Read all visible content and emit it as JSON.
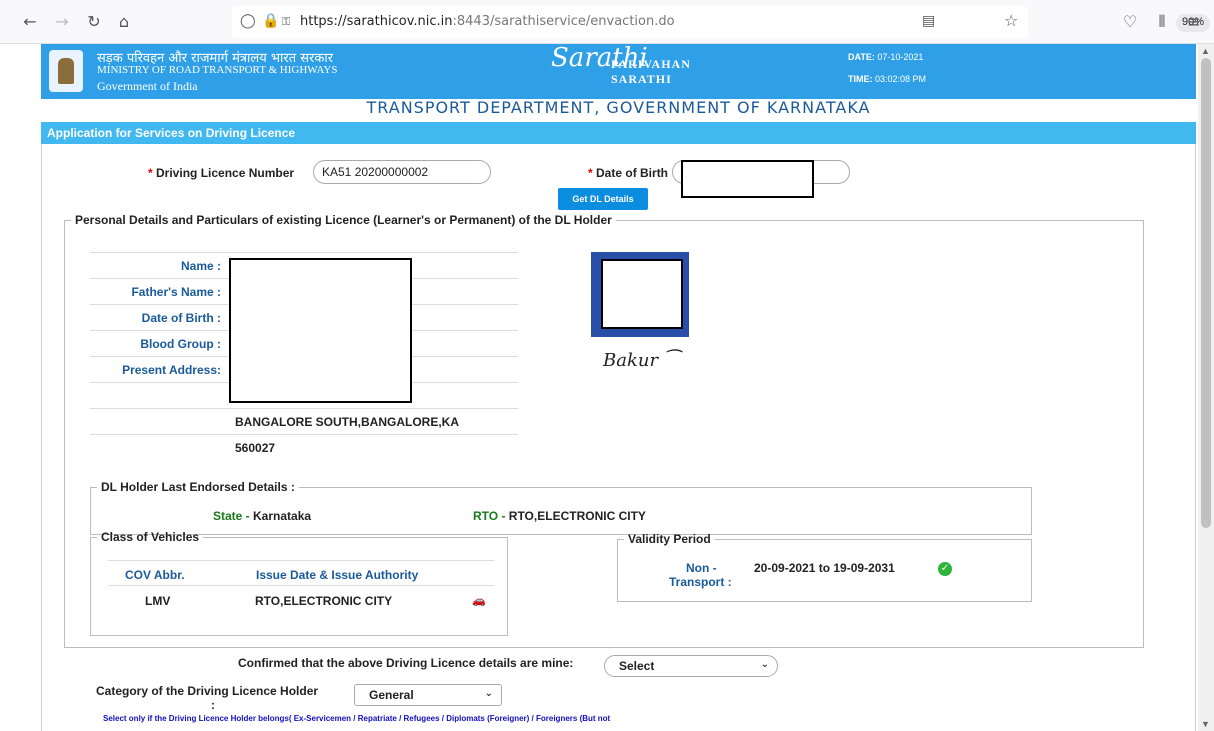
{
  "browser": {
    "url_host": "https://sarathicov.nic.in",
    "url_rest": ":8443/sarathiservice/envaction.do",
    "zoom": "90%"
  },
  "header": {
    "hindi": "सड़क परिवहन और राजमार्ग मंत्रालय भारत सरकार",
    "ministry": "MINISTRY OF ROAD TRANSPORT & HIGHWAYS",
    "gov": "Government of India",
    "logo_line1": "PARIVAHAN",
    "logo_line2": "SARATHI",
    "date_label": "DATE:",
    "date_value": "07-10-2021",
    "time_label": "TIME:",
    "time_value": "03:02:08 PM"
  },
  "dept_title": "TRANSPORT DEPARTMENT, GOVERNMENT OF KARNATAKA",
  "panel_title": "Application for Services on Driving Licence",
  "form": {
    "dl_label": "Driving Licence Number",
    "dl_value": "KA51 20200000002",
    "dob_label": "Date of Birth",
    "get_btn": "Get DL Details"
  },
  "personal": {
    "legend": "Personal Details and Particulars of existing Licence (Learner's or Permanent) of the DL Holder",
    "fields": [
      {
        "label": "Name :"
      },
      {
        "label": "Father's Name :"
      },
      {
        "label": "Date of Birth :"
      },
      {
        "label": "Blood Group :"
      },
      {
        "label": "Present Address:"
      }
    ],
    "address1": "BANGALORE SOUTH,BANGALORE,KA",
    "address2": "560027"
  },
  "endorsed": {
    "legend": "DL Holder Last Endorsed Details :",
    "state_label": "State - ",
    "state_value": "Karnataka",
    "rto_label": "RTO - ",
    "rto_value": "RTO,ELECTRONIC CITY"
  },
  "cov": {
    "legend": "Class of Vehicles",
    "col1": "COV Abbr.",
    "col2": "Issue Date & Issue Authority",
    "abbr": "LMV",
    "authority": "RTO,ELECTRONIC CITY"
  },
  "validity": {
    "legend": "Validity Period",
    "type_line1": "Non -",
    "type_line2": "Transport :",
    "range": "20-09-2021 to 19-09-2031"
  },
  "confirm": {
    "label": "Confirmed that the above Driving Licence details are mine:",
    "value": "Select"
  },
  "category": {
    "label": "Category of the Driving Licence Holder",
    "colon": ":",
    "value": "General"
  },
  "note": "Select only if the Driving Licence Holder belongs( Ex-Servicemen / Repatriate / Refugees / Diplomats (Foreigner) / Foreigners (But not"
}
